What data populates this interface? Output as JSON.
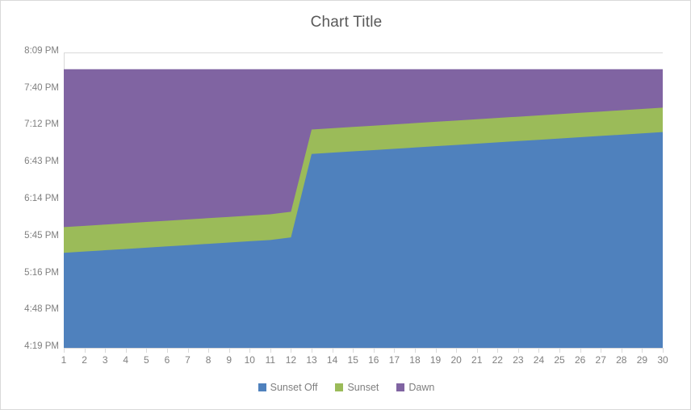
{
  "chart_data": {
    "type": "area",
    "stacked": true,
    "title": "Chart Title",
    "xlabel": "",
    "ylabel": "",
    "grid": true,
    "legend_position": "bottom",
    "x": [
      1,
      2,
      3,
      4,
      5,
      6,
      7,
      8,
      9,
      10,
      11,
      12,
      13,
      14,
      15,
      16,
      17,
      18,
      19,
      20,
      21,
      22,
      23,
      24,
      25,
      26,
      27,
      28,
      29,
      30
    ],
    "categories": [
      "1",
      "2",
      "3",
      "4",
      "5",
      "6",
      "7",
      "8",
      "9",
      "10",
      "11",
      "12",
      "13",
      "14",
      "15",
      "16",
      "17",
      "18",
      "19",
      "20",
      "21",
      "22",
      "23",
      "24",
      "25",
      "26",
      "27",
      "28",
      "29",
      "30"
    ],
    "y_tick_labels": [
      "8:09 PM",
      "7:40 PM",
      "7:12 PM",
      "6:43 PM",
      "6:14 PM",
      "5:45 PM",
      "5:16 PM",
      "4:48 PM",
      "4:19 PM"
    ],
    "y_tick_minutes": [
      1209,
      1180,
      1152,
      1123,
      1094,
      1065,
      1036,
      1008,
      979
    ],
    "ylim_minutes": [
      979,
      1209
    ],
    "ylim_labels": [
      "4:19 PM",
      "8:09 PM"
    ],
    "series": [
      {
        "name": "Sunset Off",
        "color": "#4F81BD",
        "values_minutes": [
          1053,
          1054,
          1055,
          1056,
          1057,
          1058,
          1059,
          1060,
          1061,
          1062,
          1063,
          1065,
          1130,
          1131,
          1132,
          1133,
          1134,
          1135,
          1136,
          1137,
          1138,
          1139,
          1140,
          1141,
          1142,
          1143,
          1144,
          1145,
          1146,
          1147
        ],
        "values_labels": [
          "5:33 PM",
          "5:34 PM",
          "5:35 PM",
          "5:36 PM",
          "5:37 PM",
          "5:38 PM",
          "5:39 PM",
          "5:40 PM",
          "5:41 PM",
          "5:42 PM",
          "5:43 PM",
          "5:45 PM",
          "6:50 PM",
          "6:51 PM",
          "6:52 PM",
          "6:53 PM",
          "6:54 PM",
          "6:55 PM",
          "6:56 PM",
          "6:57 PM",
          "6:58 PM",
          "6:59 PM",
          "7:00 PM",
          "7:01 PM",
          "7:02 PM",
          "7:03 PM",
          "7:04 PM",
          "7:05 PM",
          "7:06 PM",
          "7:07 PM"
        ]
      },
      {
        "name": "Sunset",
        "color": "#9BBB59",
        "values_minutes": [
          1073,
          1074,
          1075,
          1076,
          1077,
          1078,
          1079,
          1080,
          1081,
          1082,
          1083,
          1085,
          1149,
          1150,
          1151,
          1152,
          1153,
          1154,
          1155,
          1156,
          1157,
          1158,
          1159,
          1160,
          1161,
          1162,
          1163,
          1164,
          1165,
          1166
        ],
        "values_labels": [
          "5:53 PM",
          "5:54 PM",
          "5:55 PM",
          "5:56 PM",
          "5:57 PM",
          "5:58 PM",
          "5:59 PM",
          "6:00 PM",
          "6:01 PM",
          "6:02 PM",
          "6:03 PM",
          "6:05 PM",
          "7:09 PM",
          "7:10 PM",
          "7:11 PM",
          "7:12 PM",
          "7:13 PM",
          "7:14 PM",
          "7:15 PM",
          "7:16 PM",
          "7:17 PM",
          "7:18 PM",
          "7:19 PM",
          "7:20 PM",
          "7:21 PM",
          "7:22 PM",
          "7:23 PM",
          "7:24 PM",
          "7:25 PM",
          "7:26 PM"
        ]
      },
      {
        "name": "Dawn",
        "color": "#8064A2",
        "values_minutes": [
          1196,
          1196,
          1196,
          1196,
          1196,
          1196,
          1196,
          1196,
          1196,
          1196,
          1196,
          1196,
          1196,
          1196,
          1196,
          1196,
          1196,
          1196,
          1196,
          1196,
          1196,
          1196,
          1196,
          1196,
          1196,
          1196,
          1196,
          1196,
          1196,
          1196
        ],
        "values_labels": [
          "7:56 PM",
          "7:56 PM",
          "7:56 PM",
          "7:56 PM",
          "7:56 PM",
          "7:56 PM",
          "7:56 PM",
          "7:56 PM",
          "7:56 PM",
          "7:56 PM",
          "7:56 PM",
          "7:56 PM",
          "7:56 PM",
          "7:56 PM",
          "7:56 PM",
          "7:56 PM",
          "7:56 PM",
          "7:56 PM",
          "7:56 PM",
          "7:56 PM",
          "7:56 PM",
          "7:56 PM",
          "7:56 PM",
          "7:56 PM",
          "7:56 PM",
          "7:56 PM",
          "7:56 PM",
          "7:56 PM",
          "7:56 PM",
          "7:56 PM"
        ]
      }
    ]
  },
  "legend": {
    "items": [
      {
        "label": "Sunset Off",
        "color": "#4F81BD"
      },
      {
        "label": "Sunset",
        "color": "#9BBB59"
      },
      {
        "label": "Dawn",
        "color": "#8064A2"
      }
    ]
  }
}
